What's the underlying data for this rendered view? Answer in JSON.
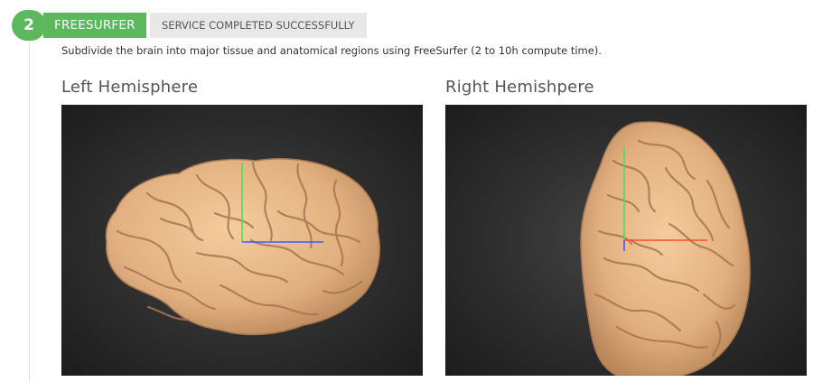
{
  "step": {
    "number": "2",
    "name": "FREESURFER",
    "status": "SERVICE COMPLETED SUCCESSFULLY",
    "description": "Subdivide the brain into major tissue and anatomical regions using FreeSurfer (2 to 10h compute time)."
  },
  "panels": {
    "left": {
      "title": "Left Hemisphere"
    },
    "right": {
      "title": "Right Hemishpere"
    }
  },
  "colors": {
    "success": "#5cb85c",
    "brain": "#e8b98a",
    "viewer_bg": "#2d2d2d"
  }
}
